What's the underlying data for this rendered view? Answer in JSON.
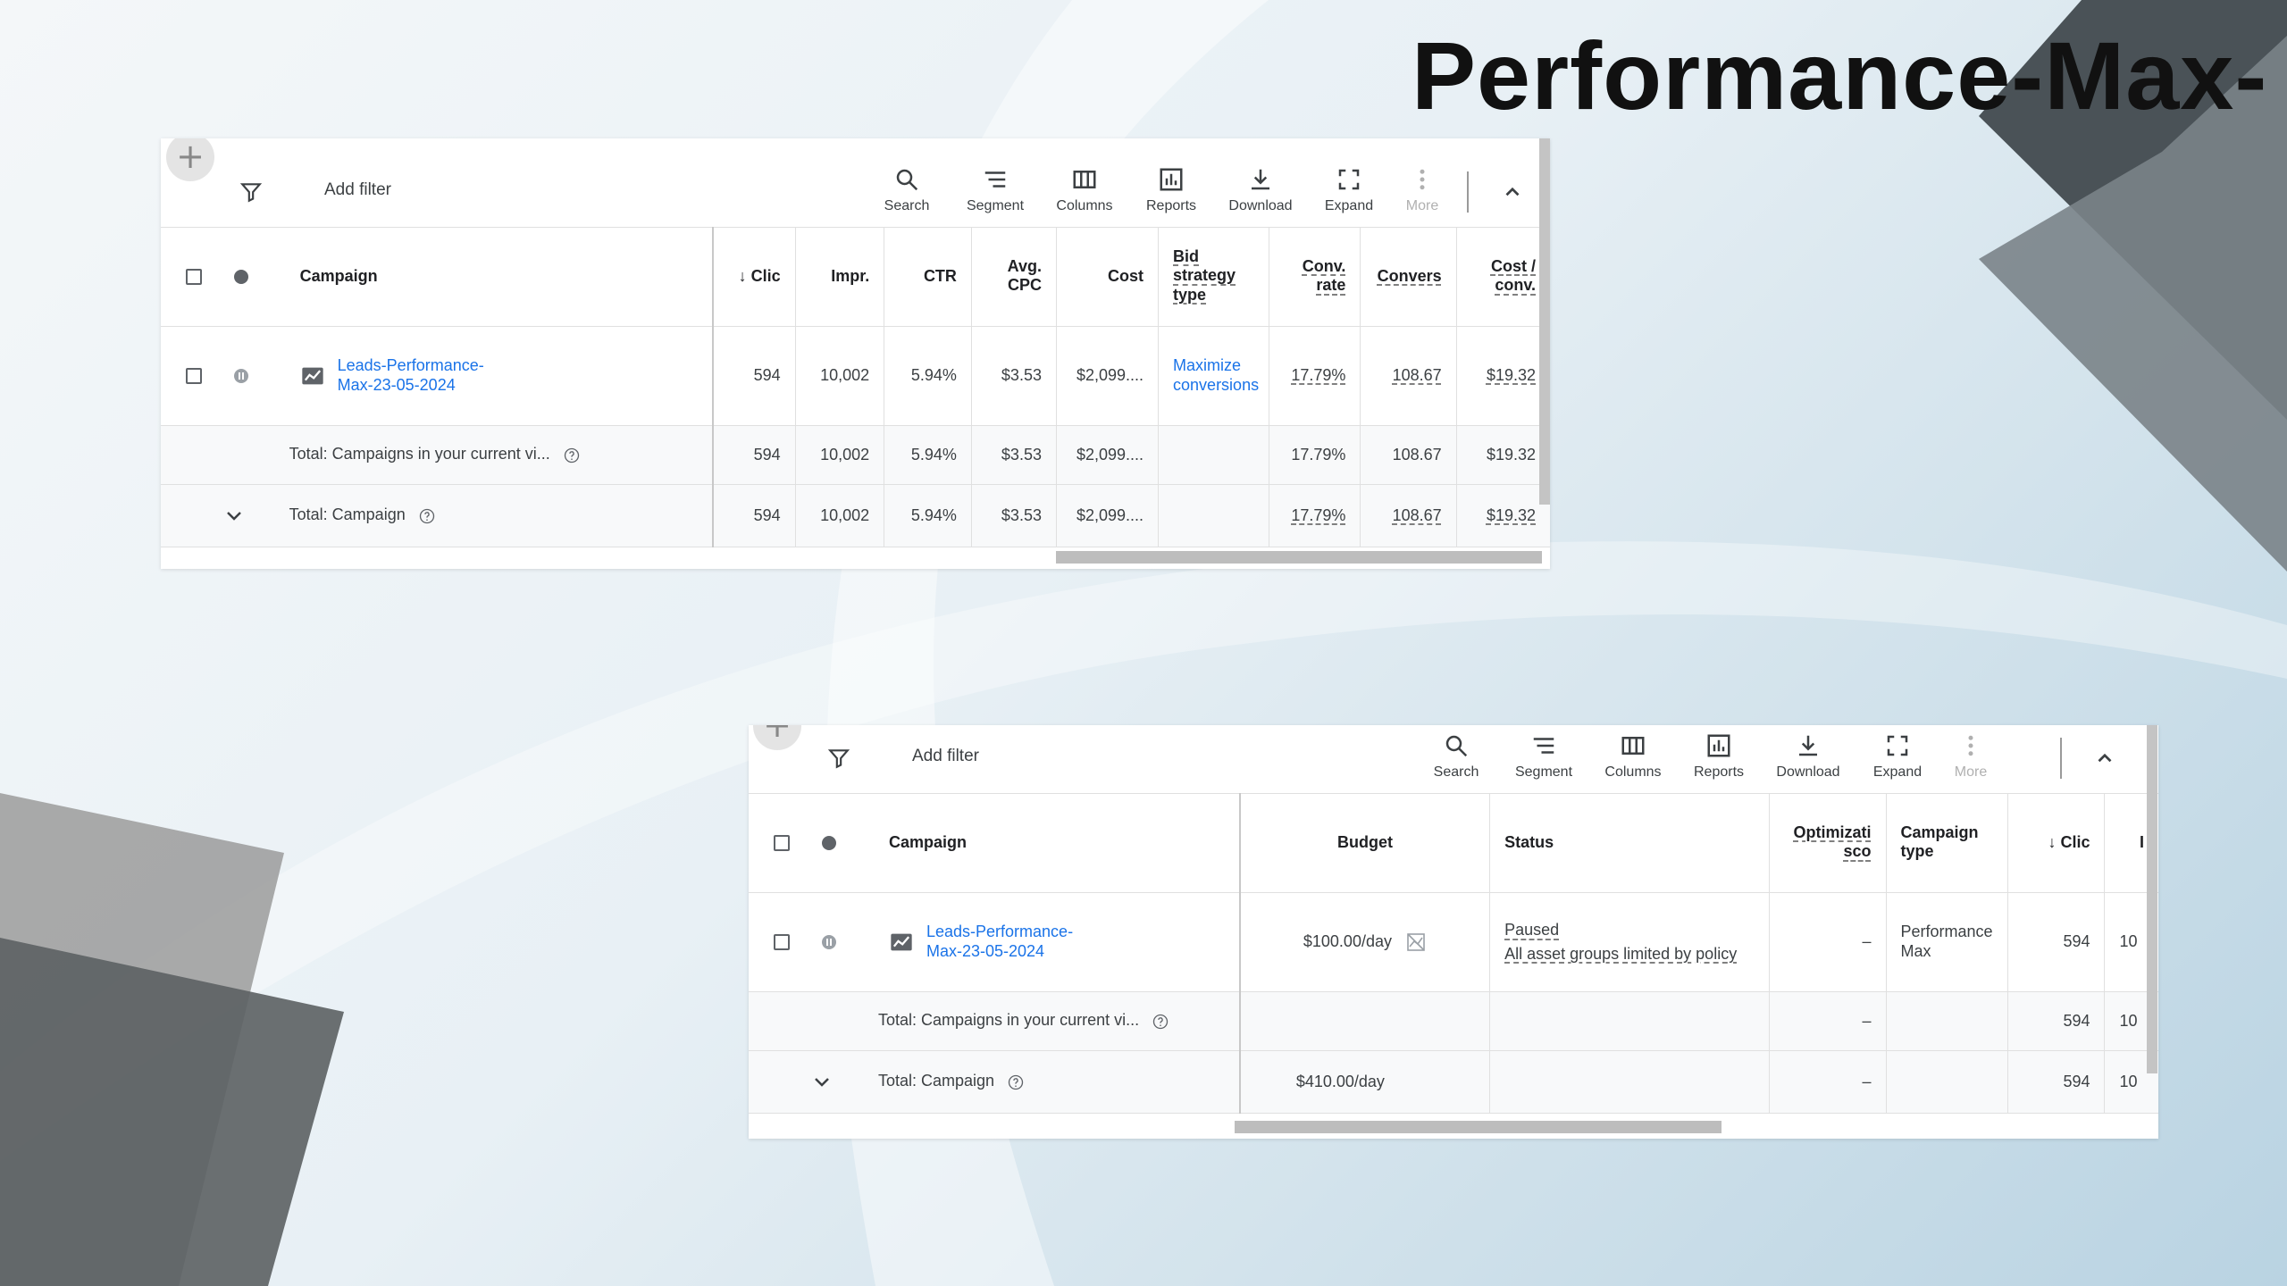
{
  "slide": {
    "title": "Performance-Max-"
  },
  "toolbar": {
    "add_filter": "Add filter",
    "search": "Search",
    "segment": "Segment",
    "columns": "Columns",
    "reports": "Reports",
    "download": "Download",
    "expand": "Expand",
    "more": "More"
  },
  "table1": {
    "headers": {
      "campaign": "Campaign",
      "clicks": "Clic",
      "impr": "Impr.",
      "ctr": "CTR",
      "avg_cpc": "Avg. CPC",
      "cost": "Cost",
      "bid_strategy": "Bid strategy type",
      "conv_rate": "Conv. rate",
      "conversions": "Convers",
      "cost_per_conv": "Cost / conv."
    },
    "row": {
      "campaign": "Leads-Performance-Max-23-05-2024",
      "clicks": "594",
      "impr": "10,002",
      "ctr": "5.94%",
      "avg_cpc": "$3.53",
      "cost": "$2,099....",
      "bid_strategy": "Maximize conversions",
      "conv_rate": "17.79%",
      "conversions": "108.67",
      "cost_per_conv": "$19.32"
    },
    "total_view": {
      "label": "Total: Campaigns in your current vi...",
      "clicks": "594",
      "impr": "10,002",
      "ctr": "5.94%",
      "avg_cpc": "$3.53",
      "cost": "$2,099....",
      "conv_rate": "17.79%",
      "conversions": "108.67",
      "cost_per_conv": "$19.32"
    },
    "total_campaign": {
      "label": "Total: Campaign",
      "clicks": "594",
      "impr": "10,002",
      "ctr": "5.94%",
      "avg_cpc": "$3.53",
      "cost": "$2,099....",
      "conv_rate": "17.79%",
      "conversions": "108.67",
      "cost_per_conv": "$19.32"
    }
  },
  "table2": {
    "headers": {
      "campaign": "Campaign",
      "budget": "Budget",
      "status": "Status",
      "optimization": "Optimizati sco",
      "campaign_type": "Campaign type",
      "clicks": "Clic",
      "impr": "I"
    },
    "row": {
      "campaign": "Leads-Performance-Max-23-05-2024",
      "budget": "$100.00/day",
      "status": "Paused",
      "status_detail": "All asset groups limited by policy",
      "optimization": "–",
      "campaign_type": "Performance Max",
      "clicks": "594",
      "impr": "10"
    },
    "total_view": {
      "label": "Total: Campaigns in your current vi...",
      "optimization": "–",
      "clicks": "594",
      "impr": "10"
    },
    "total_campaign": {
      "label": "Total: Campaign",
      "budget": "$410.00/day",
      "optimization": "–",
      "clicks": "594",
      "impr": "10"
    }
  }
}
